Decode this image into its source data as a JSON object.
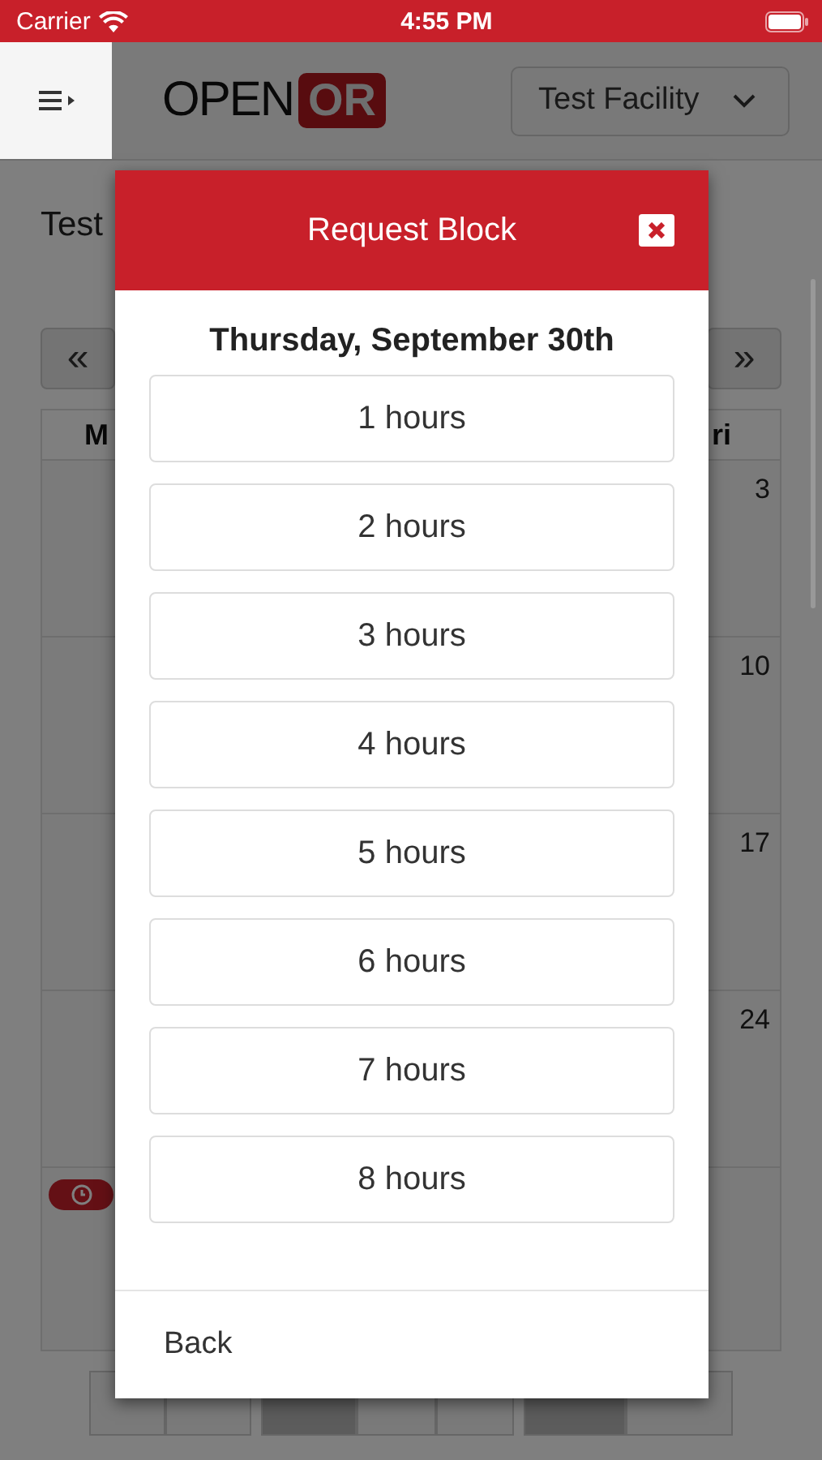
{
  "status_bar": {
    "carrier": "Carrier",
    "time": "4:55 PM"
  },
  "header": {
    "logo": {
      "left": "OPEN",
      "right": "OR"
    },
    "facility_select": "Test Facility"
  },
  "page": {
    "title": "Test",
    "prev": "«",
    "next": "»",
    "calendar": {
      "columns": [
        "M",
        "ri"
      ],
      "rows": [
        {
          "day": "3",
          "event": false
        },
        {
          "day": "10",
          "event": false
        },
        {
          "day": "17",
          "event": false
        },
        {
          "day": "24",
          "event": false
        },
        {
          "event": true
        }
      ]
    },
    "toolbar": [
      {
        "active": false
      },
      {
        "active": false
      },
      {
        "active": true
      },
      {
        "active": false
      },
      {
        "active": false
      },
      {
        "active": true
      },
      {
        "active": false
      }
    ]
  },
  "modal": {
    "title": "Request Block",
    "date": "Thursday, September 30th",
    "options": [
      "1 hours",
      "2 hours",
      "3 hours",
      "4 hours",
      "5 hours",
      "6 hours",
      "7 hours",
      "8 hours"
    ],
    "back": "Back"
  }
}
